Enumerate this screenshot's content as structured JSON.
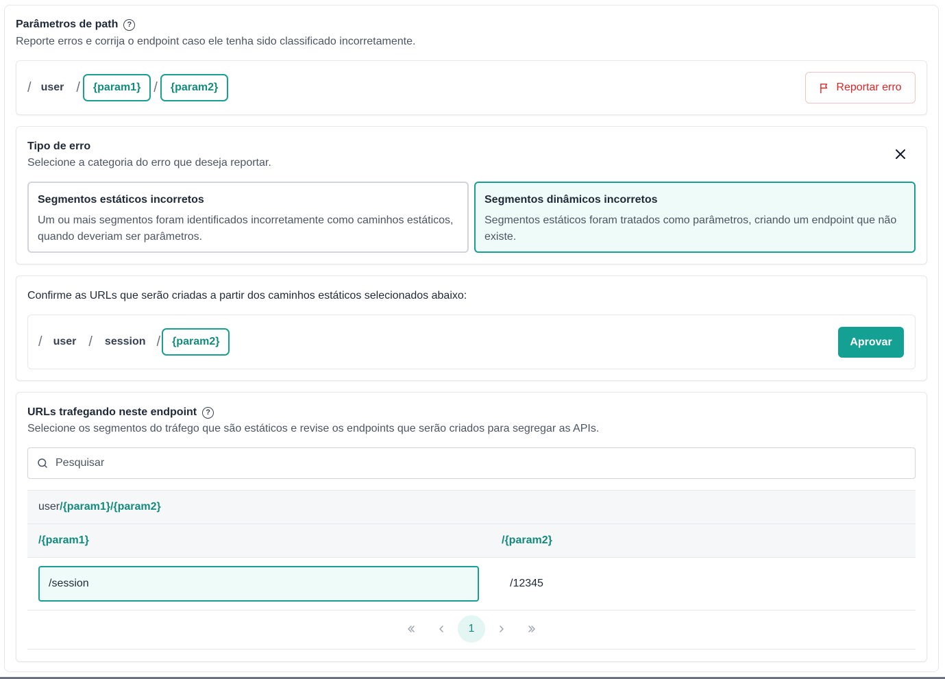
{
  "header": {
    "title": "Parâmetros de path",
    "subtitle": "Reporte erros e corrija o endpoint caso ele tenha sido classificado incorretamente."
  },
  "path": {
    "slash": "/",
    "static_segment": "user",
    "param1": "{param1}",
    "param2": "{param2}",
    "report_label": "Reportar erro"
  },
  "error_type": {
    "title": "Tipo de erro",
    "subtitle": "Selecione a categoria do erro que deseja reportar.",
    "options": [
      {
        "title": "Segmentos estáticos incorretos",
        "description": "Um ou mais segmentos foram identificados incorretamente como caminhos estáticos, quando deveriam ser parâmetros.",
        "selected": false
      },
      {
        "title": "Segmentos dinâmicos incorretos",
        "description": "Segmentos estáticos foram tratados como parâmetros, criando um endpoint que não existe.",
        "selected": true
      }
    ]
  },
  "confirm": {
    "text": "Confirme as URLs que serão criadas a partir dos caminhos estáticos selecionados abaixo:",
    "segments": [
      "user",
      "session"
    ],
    "param": "{param2}",
    "approve_label": "Aprovar"
  },
  "traffic": {
    "title": "URLs trafegando neste endpoint",
    "subtitle": "Selecione os segmentos do tráfego que são estáticos e revise os endpoints que serão criados para segregar as APIs.",
    "search_placeholder": "Pesquisar",
    "group_static": "user",
    "group_params": "/{param1}/{param2}",
    "columns": [
      "/{param1}",
      "/{param2}"
    ],
    "rows": [
      {
        "param1": "/session",
        "param2": "/12345"
      }
    ]
  },
  "pagination": {
    "current_page": "1",
    "first": "«",
    "prev": "‹",
    "next": "›",
    "last": "»"
  },
  "colors": {
    "accent": "#1a9e8f",
    "danger": "#dc2626"
  }
}
